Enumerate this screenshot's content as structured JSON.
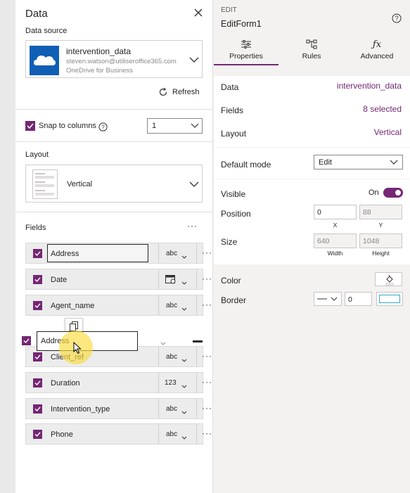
{
  "data_pane": {
    "title": "Data",
    "data_source_label": "Data source",
    "source": {
      "name": "intervention_data",
      "account": "steven.watson@utiliseroffice365.com",
      "service": "OneDrive for Business",
      "icon": "cloud-icon"
    },
    "refresh_label": "Refresh",
    "snap": {
      "label": "Snap to columns",
      "checked": true,
      "columns_value": "1"
    },
    "layout_label": "Layout",
    "layout_value": "Vertical",
    "fields_label": "Fields",
    "fields": [
      {
        "name": "Address",
        "type": "abc",
        "checked": true,
        "selected": true
      },
      {
        "name": "Date",
        "type": "calendar",
        "checked": true
      },
      {
        "name": "Agent_name",
        "type": "abc",
        "checked": true
      },
      {
        "name": "Client_ref",
        "type": "abc",
        "checked": true
      },
      {
        "name": "Duration",
        "type": "123",
        "checked": true
      },
      {
        "name": "Intervention_type",
        "type": "abc",
        "checked": true
      },
      {
        "name": "Phone",
        "type": "abc",
        "checked": true
      }
    ],
    "dragging_field": "Address",
    "more_label": "···"
  },
  "edit_pane": {
    "caption": "EDIT",
    "control_name": "EditForm1",
    "tabs": [
      {
        "label": "Properties",
        "active": true,
        "icon": "sliders-icon"
      },
      {
        "label": "Rules",
        "active": false,
        "icon": "rules-icon"
      },
      {
        "label": "Advanced",
        "active": false,
        "icon": "fx-icon"
      }
    ],
    "data": {
      "label": "Data",
      "value": "intervention_data"
    },
    "fields": {
      "label": "Fields",
      "value": "8 selected"
    },
    "layout": {
      "label": "Layout",
      "value": "Vertical"
    },
    "default_mode": {
      "label": "Default mode",
      "value": "Edit"
    },
    "visible": {
      "label": "Visible",
      "state": "On"
    },
    "position": {
      "label": "Position",
      "x": "0",
      "y": "88",
      "x_caption": "X",
      "y_caption": "Y"
    },
    "size": {
      "label": "Size",
      "width": "640",
      "height": "1048",
      "width_caption": "Width",
      "height_caption": "Height"
    },
    "color": {
      "label": "Color"
    },
    "border": {
      "label": "Border",
      "width": "0"
    }
  },
  "colors": {
    "accent": "#742774",
    "onedrive_blue": "#0f5fb5"
  }
}
